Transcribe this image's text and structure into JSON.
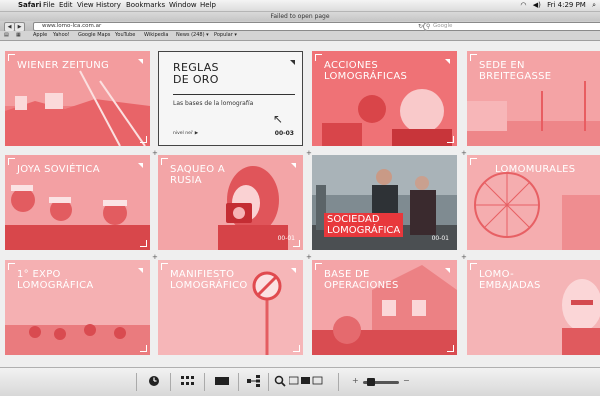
{
  "menubar": {
    "app": "Safari",
    "items": [
      "File",
      "Edit",
      "View",
      "History",
      "Bookmarks",
      "Window",
      "Help"
    ],
    "clock": "Fri 4:29 PM"
  },
  "window": {
    "title": "Failed to open page"
  },
  "toolbar": {
    "url": "www.lomo-lca.com.ar",
    "search_placeholder": "Google"
  },
  "bookmarks": [
    "Apple",
    "Yahoo!",
    "Google Maps",
    "YouTube",
    "Wikipedia",
    "News (248) ▾",
    "Popular ▾"
  ],
  "grid": [
    {
      "title": "WIENER ZEITUNG",
      "num": "",
      "style": "photo"
    },
    {
      "title": "REGLAS\nDE ORO",
      "subtitle": "Las bases de la lomografía",
      "level": "nivel nei' ▶",
      "num": "00-03",
      "style": "white"
    },
    {
      "title": "ACCIONES\nLOMOGRÁFICAS",
      "num": "",
      "style": "photo"
    },
    {
      "title": "SEDE EN\nBREITEGASSE",
      "num": "",
      "style": "photo"
    },
    {
      "title": "JOYA SOVIÉTICA",
      "num": "",
      "style": "photo"
    },
    {
      "title": "SAQUEO A\nRUSIA",
      "num": "00-01",
      "style": "photo"
    },
    {
      "title": "SOCIEDAD\nLOMOGRÁFICA",
      "num": "00-01",
      "style": "color"
    },
    {
      "title": "LOMOMURALES",
      "num": "",
      "style": "photo"
    },
    {
      "title": "1° EXPO\nLOMOGRÁFICA",
      "num": "",
      "style": "photo"
    },
    {
      "title": "MANIFIESTO\nLOMOGRÁFICO",
      "num": "",
      "style": "photo"
    },
    {
      "title": "BASE DE\nOPERACIONES",
      "num": "",
      "style": "photo"
    },
    {
      "title": "LOMO-\nEMBAJADAS",
      "num": "",
      "style": "photo"
    }
  ],
  "bottombar": {
    "icons": [
      "clock-icon",
      "grid-icon",
      "single-view-icon",
      "tree-icon",
      "zoom-icon",
      "panel-icon"
    ],
    "zoom_plus": "+",
    "zoom_minus": "−"
  },
  "colors": {
    "accent": "#e8383c",
    "tint": "#f4a9aa"
  }
}
